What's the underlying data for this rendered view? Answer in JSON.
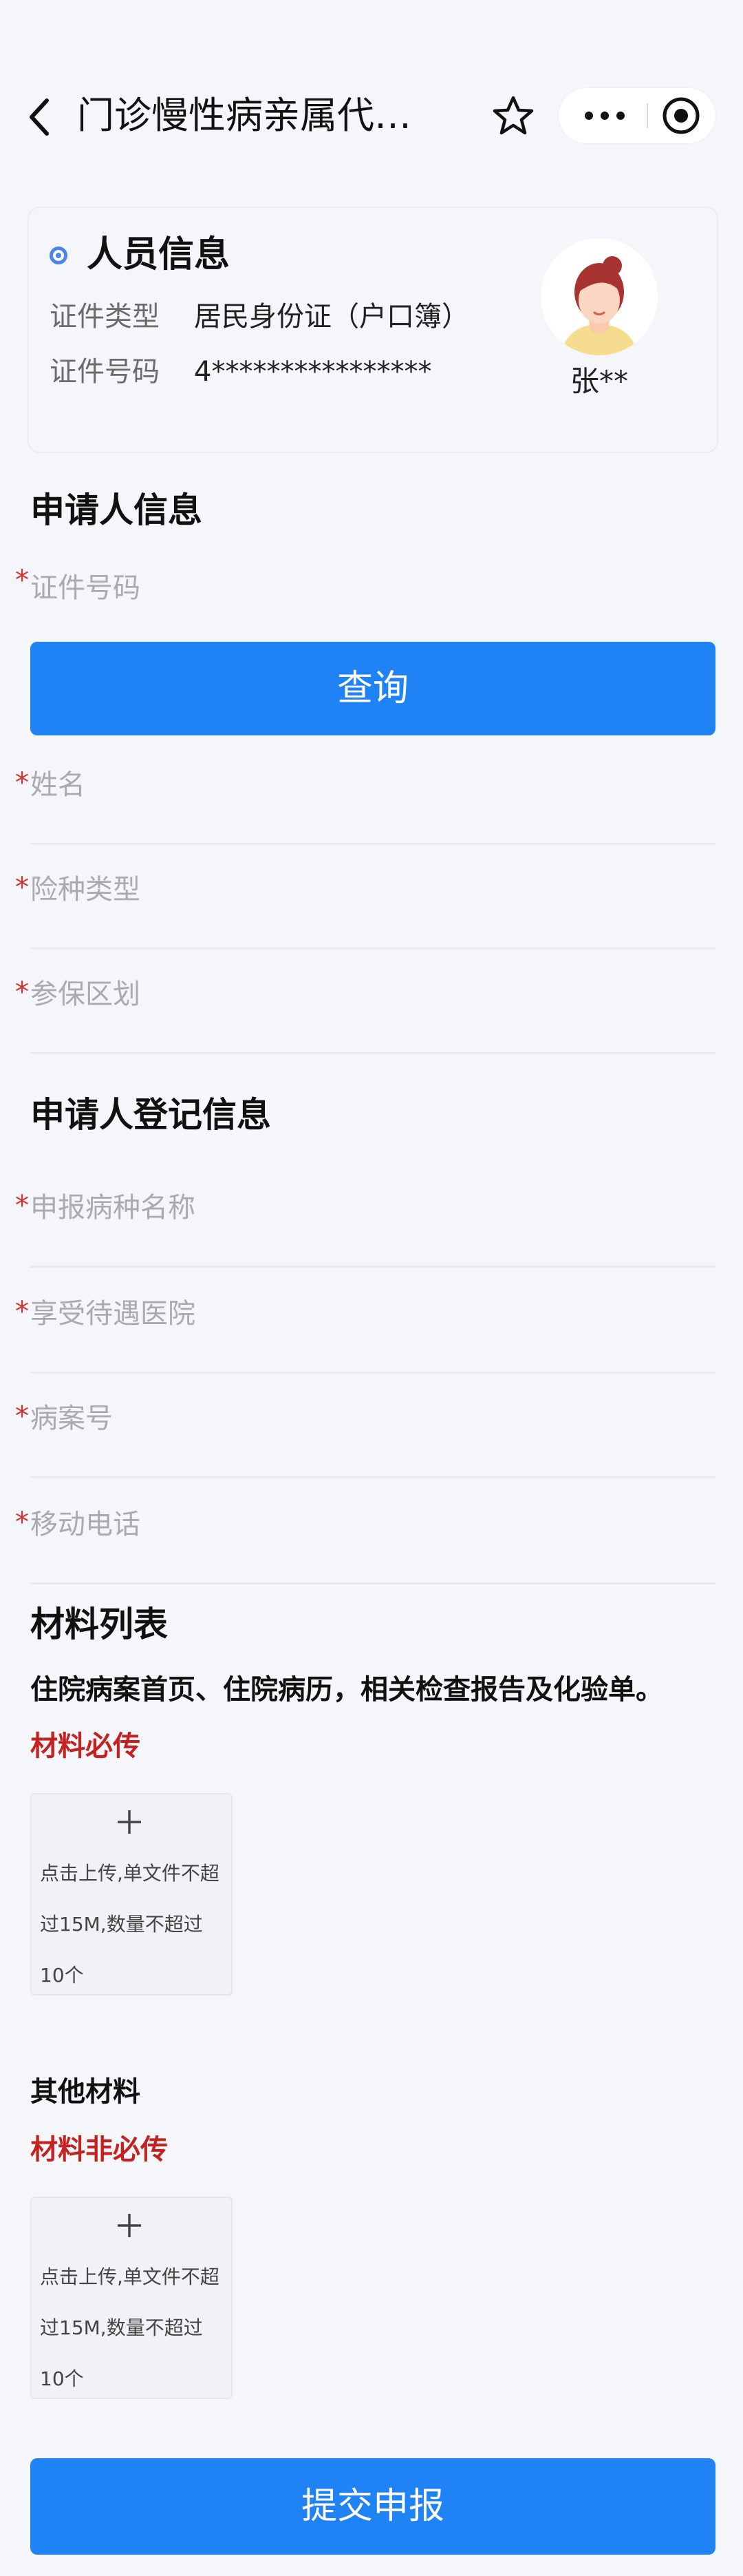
{
  "nav": {
    "title": "门诊慢性病亲属代…"
  },
  "person": {
    "title": "人员信息",
    "id_type_label": "证件类型",
    "id_type_value": "居民身份证（户口簿）",
    "id_no_label": "证件号码",
    "id_no_value": "4****************",
    "name": "张**"
  },
  "applicant": {
    "title": "申请人信息",
    "id_field": "证件号码",
    "query_button": "查询",
    "name_field": "姓名",
    "insurance_type_field": "险种类型",
    "region_field": "参保区划",
    "required_mark": "*"
  },
  "registration": {
    "title": "申请人登记信息",
    "disease_field": "申报病种名称",
    "hospital_field": "享受待遇医院",
    "case_no_field": "病案号",
    "phone_field": "移动电话"
  },
  "materials": {
    "title": "材料列表",
    "desc": "住院病案首页、住院病历，相关检查报告及化验单。",
    "required_note": "材料必传",
    "upload_text": "点击上传,单文件不超过15M,数量不超过10个",
    "other_title": "其他材料",
    "optional_note": "材料非必传"
  },
  "submit_button": "提交申报",
  "colors": {
    "primary": "#1f82f5",
    "required": "#d43030",
    "accent_dot": "#4a86e8"
  },
  "icons": [
    "back-arrow-icon",
    "star-icon",
    "more-dots-icon",
    "target-icon",
    "avatar-icon",
    "plus-icon"
  ]
}
